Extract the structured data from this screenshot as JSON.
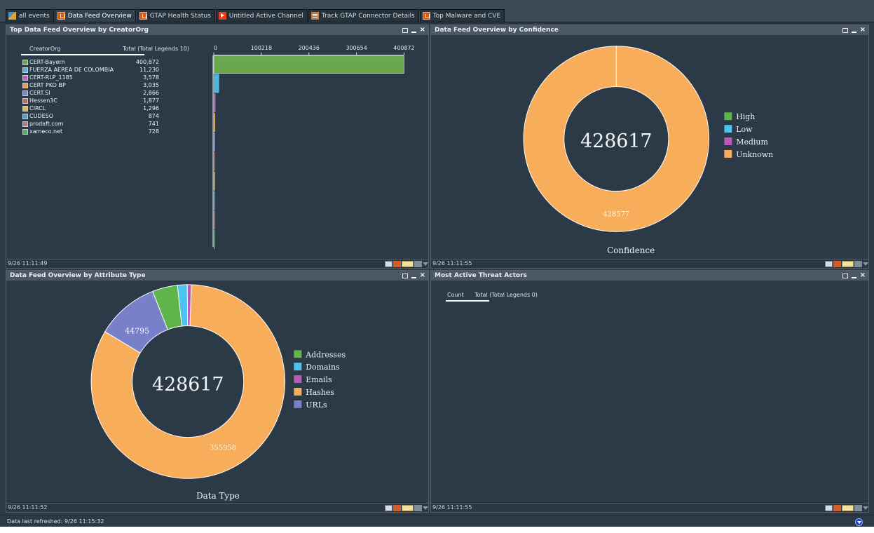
{
  "tabs": [
    {
      "label": "all events",
      "icon": "events-icon"
    },
    {
      "label": "Data Feed Overview",
      "icon": "flame-icon",
      "active": true
    },
    {
      "label": "GTAP Health Status",
      "icon": "flame-icon"
    },
    {
      "label": "Untitled Active Channel",
      "icon": "play-icon"
    },
    {
      "label": "Track GTAP Connector Details",
      "icon": "track-icon"
    },
    {
      "label": "Top Malware and CVE",
      "icon": "flame-icon"
    }
  ],
  "panels": {
    "creator": {
      "title": "Top Data Feed Overview by CreatorOrg",
      "footer": "9/26 11:11:49",
      "col1": "CreatorOrg",
      "col2": "Total (Total Legends 10)",
      "axis_ticks": [
        "0",
        "100218",
        "200436",
        "300654",
        "400872"
      ],
      "rows": [
        {
          "name": "CERT-Bayern",
          "value": "400,872",
          "color": "#6aa84f"
        },
        {
          "name": "FUERZA AEREA DE COLOMBIA",
          "value": "11,230",
          "color": "#4fb3df"
        },
        {
          "name": "CERT-RLP_1185",
          "value": "3,578",
          "color": "#b968b5"
        },
        {
          "name": "CERT PKO BP",
          "value": "3,035",
          "color": "#e79d45"
        },
        {
          "name": "CERT.SI",
          "value": "2,866",
          "color": "#7a86c9"
        },
        {
          "name": "Hessen3C",
          "value": "1,877",
          "color": "#b66c61"
        },
        {
          "name": "CIRCL",
          "value": "1,296",
          "color": "#d8bf4b"
        },
        {
          "name": "CUDESO",
          "value": "874",
          "color": "#59a1c8"
        },
        {
          "name": "prodaft.com",
          "value": "741",
          "color": "#b07f7f"
        },
        {
          "name": "xameco.net",
          "value": "728",
          "color": "#56ac68"
        }
      ]
    },
    "confidence": {
      "title": "Data Feed Overview by Confidence",
      "footer": "9/26 11:11:55",
      "center_value": "428617",
      "segment_label": "428577",
      "caption": "Confidence",
      "legend": [
        {
          "label": "High",
          "color": "#5fb54a"
        },
        {
          "label": "Low",
          "color": "#4cc4f0"
        },
        {
          "label": "Medium",
          "color": "#ba5ab7"
        },
        {
          "label": "Unknown",
          "color": "#f7ad5a"
        }
      ]
    },
    "attribute": {
      "title": "Data Feed Overview by Attribute Type",
      "footer": "9/26 11:11:52",
      "center_value": "428617",
      "label_urls": "44795",
      "label_hashes": "355958",
      "caption": "Data Type",
      "legend": [
        {
          "label": "Addresses",
          "color": "#5fb54a"
        },
        {
          "label": "Domains",
          "color": "#4cc4f0"
        },
        {
          "label": "Emails",
          "color": "#ba5ab7"
        },
        {
          "label": "Hashes",
          "color": "#f7ad5a"
        },
        {
          "label": "URLs",
          "color": "#7880c9"
        }
      ]
    },
    "threat": {
      "title": "Most Active Threat Actors",
      "footer": "9/26 11:11:55",
      "count_label": "Count",
      "total_label": "Total (Total Legends 0)"
    }
  },
  "status": "Data last refreshed: 9/26 11:15:32",
  "chart_data": [
    {
      "type": "bar",
      "title": "Top Data Feed Overview by CreatorOrg",
      "categories": [
        "CERT-Bayern",
        "FUERZA AEREA DE COLOMBIA",
        "CERT-RLP_1185",
        "CERT PKO BP",
        "CERT.SI",
        "Hessen3C",
        "CIRCL",
        "CUDESO",
        "prodaft.com",
        "xameco.net"
      ],
      "values": [
        400872,
        11230,
        3578,
        3035,
        2866,
        1877,
        1296,
        874,
        741,
        728
      ],
      "xlim": [
        0,
        400872
      ]
    },
    {
      "type": "pie",
      "title": "Data Feed Overview by Confidence",
      "labels": [
        "High",
        "Low",
        "Medium",
        "Unknown"
      ],
      "values": [
        10,
        10,
        20,
        428577
      ]
    },
    {
      "type": "pie",
      "title": "Data Feed Overview by Attribute Type",
      "labels": [
        "Addresses",
        "Domains",
        "Emails",
        "Hashes",
        "URLs"
      ],
      "values": [
        18000,
        7000,
        2864,
        355958,
        44795
      ]
    }
  ]
}
